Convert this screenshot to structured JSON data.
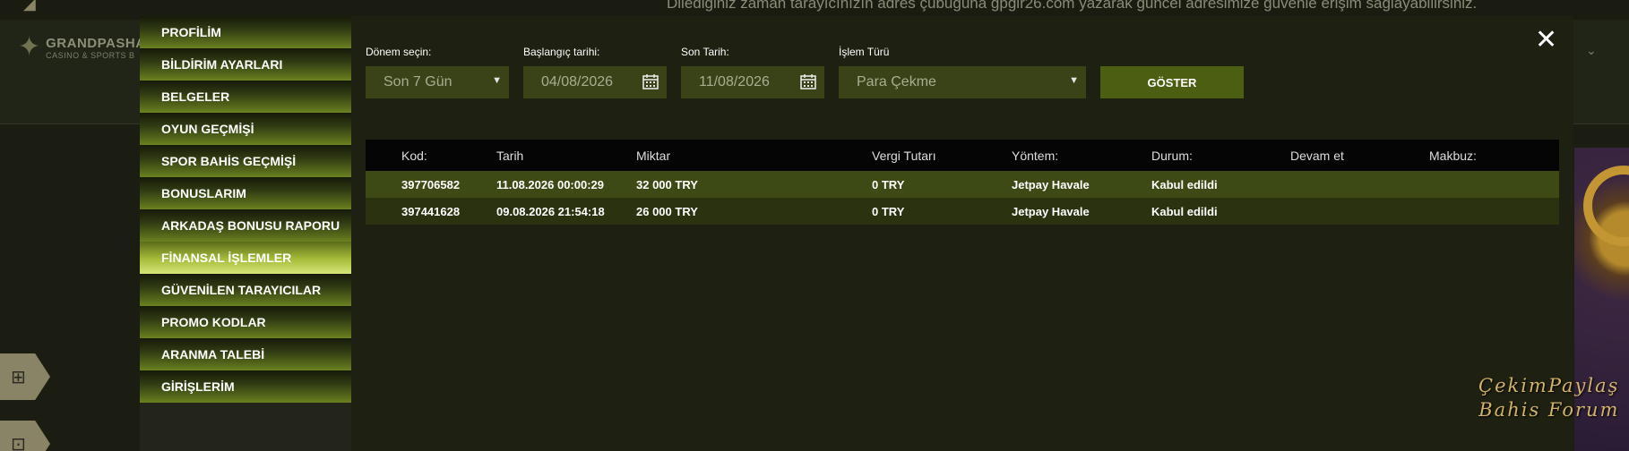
{
  "background": {
    "marquee": "Dilediğiniz zaman tarayıcınızın adres çubuğuna gpgir26.com yazarak güncel adresimize güvenle erişim sağlayabilirsiniz.",
    "logo_name": "GRANDPASHA",
    "logo_sub": "CASINO & SPORTS B",
    "watermark_line1": "ÇekimPaylaş",
    "watermark_line2": "Bahis Forum"
  },
  "sidebar": {
    "items": [
      {
        "label": "PROFİLİM",
        "active": false
      },
      {
        "label": "BİLDİRİM AYARLARI",
        "active": false
      },
      {
        "label": "BELGELER",
        "active": false
      },
      {
        "label": "OYUN GEÇMİŞİ",
        "active": false
      },
      {
        "label": "SPOR BAHİS GEÇMİŞİ",
        "active": false
      },
      {
        "label": "BONUSLARIM",
        "active": false
      },
      {
        "label": "ARKADAŞ BONUSU RAPORU",
        "active": false
      },
      {
        "label": "FİNANSAL İŞLEMLER",
        "active": true
      },
      {
        "label": "GÜVENİLEN TARAYICILAR",
        "active": false
      },
      {
        "label": "PROMO KODLAR",
        "active": false
      },
      {
        "label": "ARANMA TALEBİ",
        "active": false
      },
      {
        "label": "GİRİŞLERİM",
        "active": false
      }
    ]
  },
  "filters": {
    "period_label": "Dönem seçin:",
    "period_value": "Son 7 Gün",
    "start_label": "Başlangıç tarihi:",
    "start_value": "04/08/2026",
    "end_label": "Son Tarih:",
    "end_value": "11/08/2026",
    "type_label": "İşlem Türü",
    "type_value": "Para Çekme",
    "show_button": "GÖSTER"
  },
  "table": {
    "headers": [
      "Kod:",
      "Tarih",
      "Miktar",
      "Vergi Tutarı",
      "Yöntem:",
      "Durum:",
      "Devam et",
      "Makbuz:"
    ],
    "rows": [
      [
        "397706582",
        "11.08.2026 00:00:29",
        "32 000 TRY",
        "0 TRY",
        "Jetpay Havale",
        "Kabul edildi",
        "",
        ""
      ],
      [
        "397441628",
        "09.08.2026 21:54:18",
        "26 000 TRY",
        "0 TRY",
        "Jetpay Havale",
        "Kabul edildi",
        "",
        ""
      ]
    ]
  },
  "colors": {
    "accent": "#4b5e11",
    "active_menu": "#d7e57a",
    "row_highlight": "#3e4a15"
  },
  "icons": {
    "close": "close-icon",
    "calendar": "calendar-icon",
    "dropdown": "chevron-down-icon"
  }
}
